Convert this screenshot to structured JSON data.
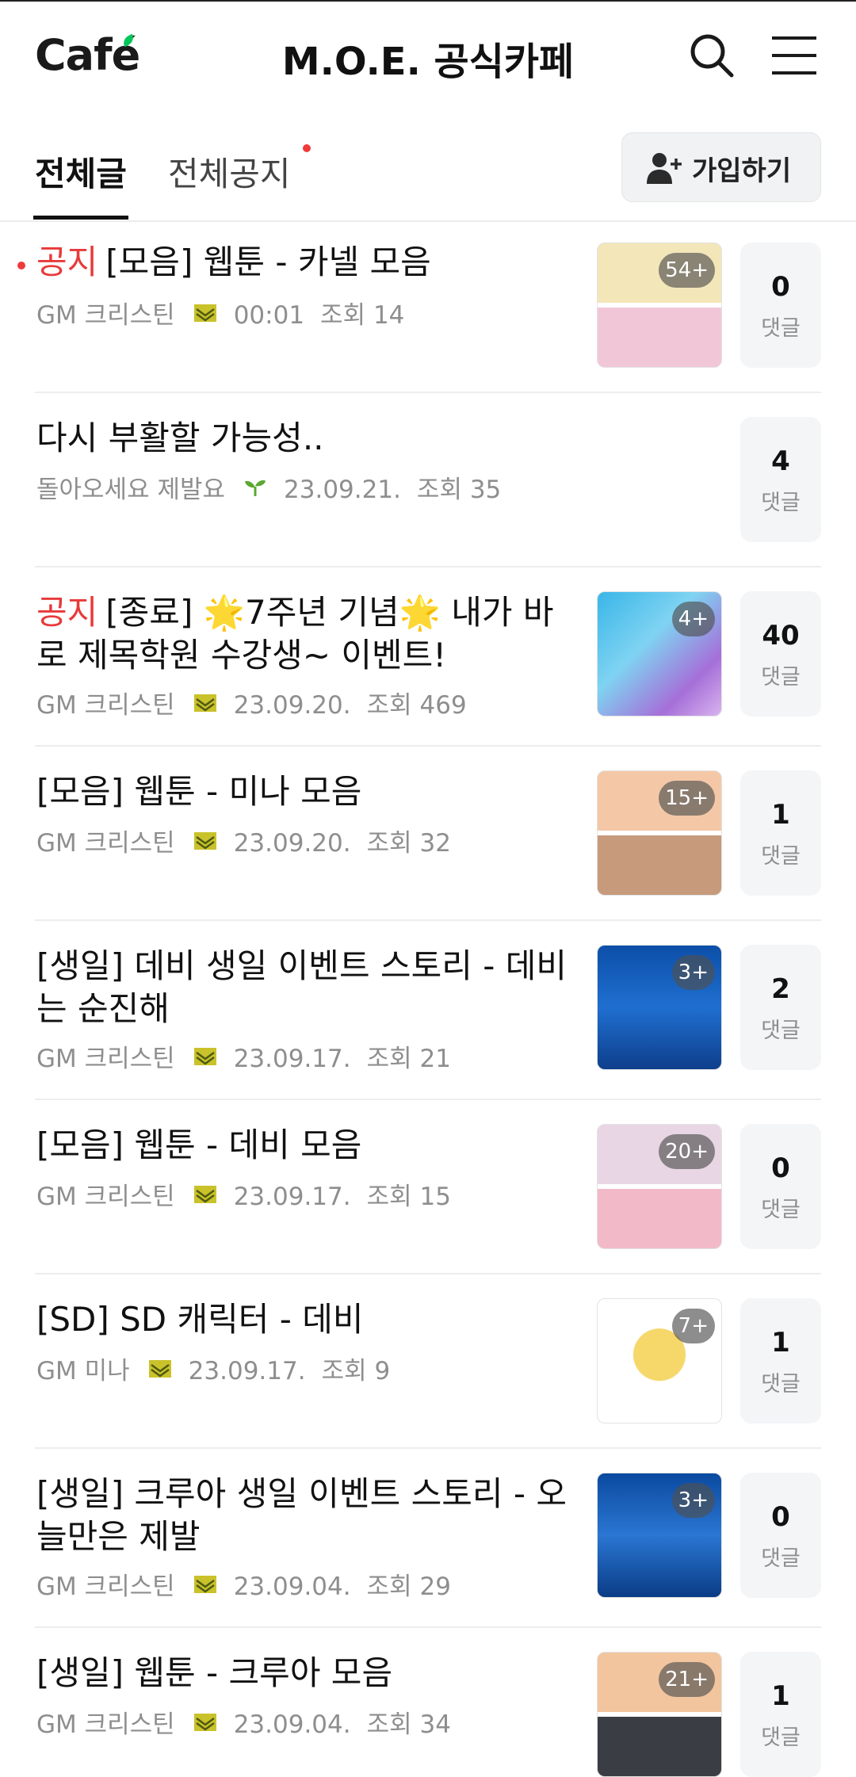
{
  "header": {
    "logo": "Café",
    "title": "M.O.E. 공식카페"
  },
  "tabs": {
    "all": "전체글",
    "notice": "전체공지",
    "join_label": "가입하기"
  },
  "colors": {
    "accent_red": "#e83a3a",
    "brand_green": "#03c75a",
    "meta_gray": "#8e8e8e"
  },
  "posts": [
    {
      "prefix": "공지",
      "title": "[모음] 웹툰 - 카넬 모음",
      "author": "GM 크리스틴",
      "badge": "staff-badge-icon",
      "date": "00:01",
      "views": "조회 14",
      "thumb_count": "54+",
      "comments": "0",
      "comment_label": "댓글"
    },
    {
      "prefix": "",
      "title": "다시 부활할 가능성..",
      "author": "돌아오세요 제발요",
      "badge": "sprout-icon",
      "date": "23.09.21.",
      "views": "조회 35",
      "thumb_count": "",
      "comments": "4",
      "comment_label": "댓글"
    },
    {
      "prefix": "공지",
      "title": "[종료] 🌟7주년 기념🌟 내가 바로 제목학원 수강생~ 이벤트!",
      "author": "GM 크리스틴",
      "badge": "staff-badge-icon",
      "date": "23.09.20.",
      "views": "조회 469",
      "thumb_count": "4+",
      "comments": "40",
      "comment_label": "댓글"
    },
    {
      "prefix": "",
      "title": "[모음] 웹툰 - 미나 모음",
      "author": "GM 크리스틴",
      "badge": "staff-badge-icon",
      "date": "23.09.20.",
      "views": "조회 32",
      "thumb_count": "15+",
      "comments": "1",
      "comment_label": "댓글"
    },
    {
      "prefix": "",
      "title": "[생일] 데비 생일 이벤트 스토리 - 데비는 순진해",
      "author": "GM 크리스틴",
      "badge": "staff-badge-icon",
      "date": "23.09.17.",
      "views": "조회 21",
      "thumb_count": "3+",
      "comments": "2",
      "comment_label": "댓글"
    },
    {
      "prefix": "",
      "title": "[모음] 웹툰 - 데비 모음",
      "author": "GM 크리스틴",
      "badge": "staff-badge-icon",
      "date": "23.09.17.",
      "views": "조회 15",
      "thumb_count": "20+",
      "comments": "0",
      "comment_label": "댓글"
    },
    {
      "prefix": "",
      "title": "[SD] SD 캐릭터 - 데비",
      "author": "GM 미나",
      "badge": "staff-badge-icon",
      "date": "23.09.17.",
      "views": "조회 9",
      "thumb_count": "7+",
      "comments": "1",
      "comment_label": "댓글"
    },
    {
      "prefix": "",
      "title": "[생일] 크루아 생일 이벤트 스토리 - 오늘만은 제발",
      "author": "GM 크리스틴",
      "badge": "staff-badge-icon",
      "date": "23.09.04.",
      "views": "조회 29",
      "thumb_count": "3+",
      "comments": "0",
      "comment_label": "댓글"
    },
    {
      "prefix": "",
      "title": "[생일] 웹툰 - 크루아 모음",
      "author": "GM 크리스틴",
      "badge": "staff-badge-icon",
      "date": "23.09.04.",
      "views": "조회 34",
      "thumb_count": "21+",
      "comments": "1",
      "comment_label": "댓글"
    }
  ]
}
